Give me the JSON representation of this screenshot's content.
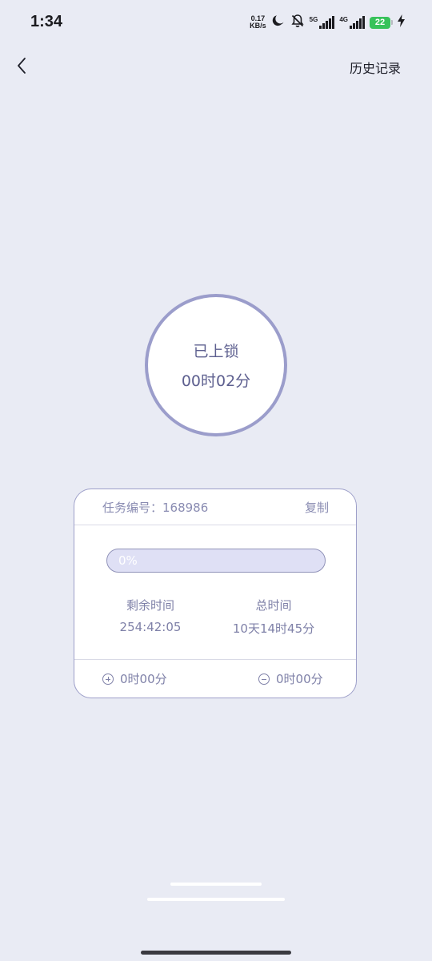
{
  "status_bar": {
    "time": "1:34",
    "net_speed_value": "0.17",
    "net_speed_unit": "KB/s",
    "signal_5g_label": "5G",
    "signal_4g_label": "4G",
    "battery_level": "22",
    "icons": [
      "moon-icon",
      "bell-muted-icon",
      "signal-icon",
      "battery-icon",
      "charging-icon"
    ]
  },
  "nav": {
    "back_icon": "chevron-left-icon",
    "history_label": "历史记录"
  },
  "lock": {
    "status": "已上锁",
    "duration": "00时02分"
  },
  "task": {
    "id_label": "任务编号：168986",
    "copy_label": "复制",
    "progress_text": "0%",
    "progress_value": 0,
    "remaining_label": "剩余时间",
    "remaining_value": "254:42:05",
    "total_label": "总时间",
    "total_value": "10天14时45分",
    "add_label": "0时00分",
    "subtract_label": "0时00分"
  },
  "colors": {
    "background": "#e9ebf4",
    "accent": "#9b9dcb",
    "text_muted": "#7f81a8",
    "progress_track": "#dfe0f5"
  }
}
